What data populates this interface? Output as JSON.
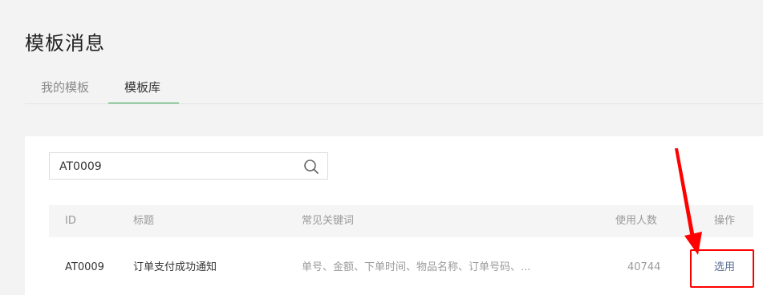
{
  "page": {
    "title": "模板消息"
  },
  "tabs": [
    {
      "label": "我的模板",
      "active": false
    },
    {
      "label": "模板库",
      "active": true
    }
  ],
  "search": {
    "value": "AT0009",
    "icon": "search-icon"
  },
  "table": {
    "columns": [
      "ID",
      "标题",
      "常见关键词",
      "使用人数",
      "操作"
    ],
    "rows": [
      {
        "id": "AT0009",
        "title": "订单支付成功通知",
        "keywords": "单号、金额、下单时间、物品名称、订单号码、...",
        "users": "40744",
        "action": "选用"
      }
    ]
  },
  "colors": {
    "accent": "#2fa84f",
    "link": "#576b95",
    "annotation": "#ff0000"
  }
}
